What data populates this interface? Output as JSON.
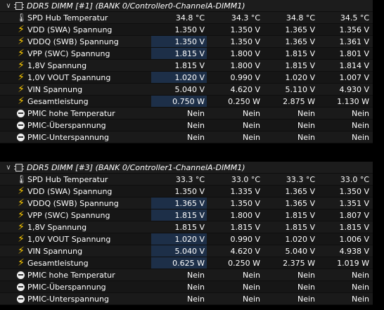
{
  "sections": [
    {
      "title": "DDR5 DIMM [#1] (BANK 0/Controller0-ChannelA-DIMM1)",
      "rows": [
        {
          "icon": "thermometer-icon",
          "label": "SPD Hub Temperatur",
          "v": [
            "34.8 °C",
            "34.3 °C",
            "34.8 °C",
            "34.5 °C"
          ],
          "hl": false
        },
        {
          "icon": "bolt-icon",
          "label": "VDD (SWA) Spannung",
          "v": [
            "1.350 V",
            "1.350 V",
            "1.365 V",
            "1.356 V"
          ],
          "hl": false
        },
        {
          "icon": "bolt-icon",
          "label": "VDDQ (SWB) Spannung",
          "v": [
            "1.350 V",
            "1.350 V",
            "1.365 V",
            "1.361 V"
          ],
          "hl": true
        },
        {
          "icon": "bolt-icon",
          "label": "VPP (SWC) Spannung",
          "v": [
            "1.815 V",
            "1.800 V",
            "1.815 V",
            "1.801 V"
          ],
          "hl": true
        },
        {
          "icon": "bolt-icon",
          "label": "1,8V Spannung",
          "v": [
            "1.815 V",
            "1.800 V",
            "1.815 V",
            "1.814 V"
          ],
          "hl": false
        },
        {
          "icon": "bolt-icon",
          "label": "1,0V VOUT Spannung",
          "v": [
            "1.020 V",
            "0.990 V",
            "1.020 V",
            "1.007 V"
          ],
          "hl": true
        },
        {
          "icon": "bolt-icon",
          "label": "VIN Spannung",
          "v": [
            "5.040 V",
            "4.620 V",
            "5.110 V",
            "4.930 V"
          ],
          "hl": false
        },
        {
          "icon": "bolt-icon",
          "label": "Gesamtleistung",
          "v": [
            "0.750 W",
            "0.250 W",
            "2.875 W",
            "1.130 W"
          ],
          "hl": true
        },
        {
          "icon": "status-icon",
          "label": "PMIC hohe Temperatur",
          "v": [
            "Nein",
            "Nein",
            "Nein",
            "Nein"
          ],
          "hl": false
        },
        {
          "icon": "status-icon",
          "label": "PMIC-Überspannung",
          "v": [
            "Nein",
            "Nein",
            "Nein",
            "Nein"
          ],
          "hl": false
        },
        {
          "icon": "status-icon",
          "label": "PMIC-Unterspannung",
          "v": [
            "Nein",
            "Nein",
            "Nein",
            "Nein"
          ],
          "hl": false
        }
      ]
    },
    {
      "title": "DDR5 DIMM [#3] (BANK 0/Controller1-ChannelA-DIMM1)",
      "rows": [
        {
          "icon": "thermometer-icon",
          "label": "SPD Hub Temperatur",
          "v": [
            "33.3 °C",
            "33.0 °C",
            "33.3 °C",
            "33.0 °C"
          ],
          "hl": false
        },
        {
          "icon": "bolt-icon",
          "label": "VDD (SWA) Spannung",
          "v": [
            "1.350 V",
            "1.335 V",
            "1.365 V",
            "1.350 V"
          ],
          "hl": false
        },
        {
          "icon": "bolt-icon",
          "label": "VDDQ (SWB) Spannung",
          "v": [
            "1.365 V",
            "1.350 V",
            "1.365 V",
            "1.351 V"
          ],
          "hl": true
        },
        {
          "icon": "bolt-icon",
          "label": "VPP (SWC) Spannung",
          "v": [
            "1.815 V",
            "1.800 V",
            "1.815 V",
            "1.807 V"
          ],
          "hl": true
        },
        {
          "icon": "bolt-icon",
          "label": "1,8V Spannung",
          "v": [
            "1.815 V",
            "1.815 V",
            "1.815 V",
            "1.815 V"
          ],
          "hl": false
        },
        {
          "icon": "bolt-icon",
          "label": "1,0V VOUT Spannung",
          "v": [
            "1.020 V",
            "0.990 V",
            "1.020 V",
            "1.006 V"
          ],
          "hl": true
        },
        {
          "icon": "bolt-icon",
          "label": "VIN Spannung",
          "v": [
            "5.040 V",
            "4.620 V",
            "5.040 V",
            "4.938 V"
          ],
          "hl": true
        },
        {
          "icon": "bolt-icon",
          "label": "Gesamtleistung",
          "v": [
            "0.625 W",
            "0.250 W",
            "2.375 W",
            "1.019 W"
          ],
          "hl": true
        },
        {
          "icon": "status-icon",
          "label": "PMIC hohe Temperatur",
          "v": [
            "Nein",
            "Nein",
            "Nein",
            "Nein"
          ],
          "hl": false
        },
        {
          "icon": "status-icon",
          "label": "PMIC-Überspannung",
          "v": [
            "Nein",
            "Nein",
            "Nein",
            "Nein"
          ],
          "hl": false
        },
        {
          "icon": "status-icon",
          "label": "PMIC-Unterspannung",
          "v": [
            "Nein",
            "Nein",
            "Nein",
            "Nein"
          ],
          "hl": false
        }
      ]
    }
  ],
  "colors": {
    "highlight": "#1d2f48",
    "bolt": "#ffcc00",
    "background": "#000000"
  }
}
